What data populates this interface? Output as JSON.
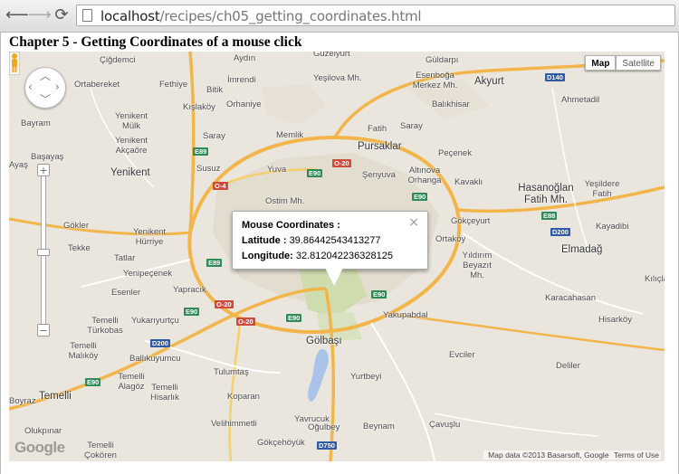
{
  "browser": {
    "url_host": "localhost",
    "url_path": "/recipes/ch05_getting_coordinates.html",
    "back_glyph": "⟵",
    "forward_glyph": "⟶",
    "reload_glyph": "⟳"
  },
  "page": {
    "heading": "Chapter 5 - Getting Coordinates of a mouse click"
  },
  "map": {
    "map_type": {
      "map": "Map",
      "satellite": "Satellite"
    },
    "infowindow": {
      "title": "Mouse Coordinates :",
      "lat_label": "Latitude :",
      "lat_value": "39.86442543413277",
      "lng_label": "Longitude:",
      "lng_value": "32.812042236328125",
      "close": "×"
    },
    "zoom_in": "+",
    "zoom_out": "−",
    "logo": "Google",
    "attribution": {
      "data": "Map data ©2013 Basarsoft, Google",
      "terms": "Terms of Use"
    },
    "labels": [
      "Çiğdemci",
      "Aydın",
      "Guzelyurt",
      "Güldarpı",
      "Ortabereket",
      "Fethiye",
      "Bitik",
      "İmrendi",
      "Yeşilova Mh.",
      "Esenboğa Merkez Mh.",
      "Akyurt",
      "Kışlaköy",
      "Orhaniye",
      "Balıkhisar",
      "Ahmetadil",
      "Bayram",
      "Yenikent Mülk",
      "Fatih",
      "Saray",
      "Memlik",
      "Saray",
      "Pursaklar",
      "Peçenek",
      "Başayaş",
      "Yenikent Akçaöre",
      "Yenikent",
      "Susuz",
      "Yuva",
      "Şenyuva",
      "Altınova Orhanga",
      "Kavaklı",
      "Hasanoğlan Fatih Mh.",
      "Yeşildere Fatih",
      "Ostim Mh.",
      "Gökçeyurt",
      "Kayadibi",
      "Gökler",
      "Yenikent Hürriye",
      "Ortaköy",
      "Yıldırım Beyazıt Mh.",
      "Elmadağ",
      "Tekke",
      "Tatlar",
      "Yenipeçenek",
      "Kılıçla",
      "Esenler",
      "Yapracık",
      "Karacahasan",
      "Temelli Türkobas",
      "Yukarıyurtçu",
      "Yakupabdal",
      "Hisarköy",
      "Temelli Malıköy",
      "Ballıkuyumcu",
      "Gölbaşı",
      "Evciler",
      "Deliler",
      "Tulumtaş",
      "Yurtbeyi",
      "Temelli",
      "Temelli Alagöz",
      "Temelli Hisarlık",
      "Koparan",
      "Velihimmetli",
      "Yavrucuk",
      "Beynam",
      "Çavuşlu",
      "Olukpınar",
      "Gökçehöyük",
      "Oğulbey",
      "Temelli Çokören",
      "Ayaş",
      "Boyraz"
    ],
    "road_shields": {
      "green": [
        "E89",
        "E90",
        "E90",
        "E88",
        "E89",
        "E90",
        "E90",
        "E90",
        "E90"
      ],
      "red": [
        "O-20",
        "O-4",
        "O-20",
        "O-20"
      ],
      "blue": [
        "D140",
        "D200",
        "D200",
        "D750"
      ]
    }
  }
}
